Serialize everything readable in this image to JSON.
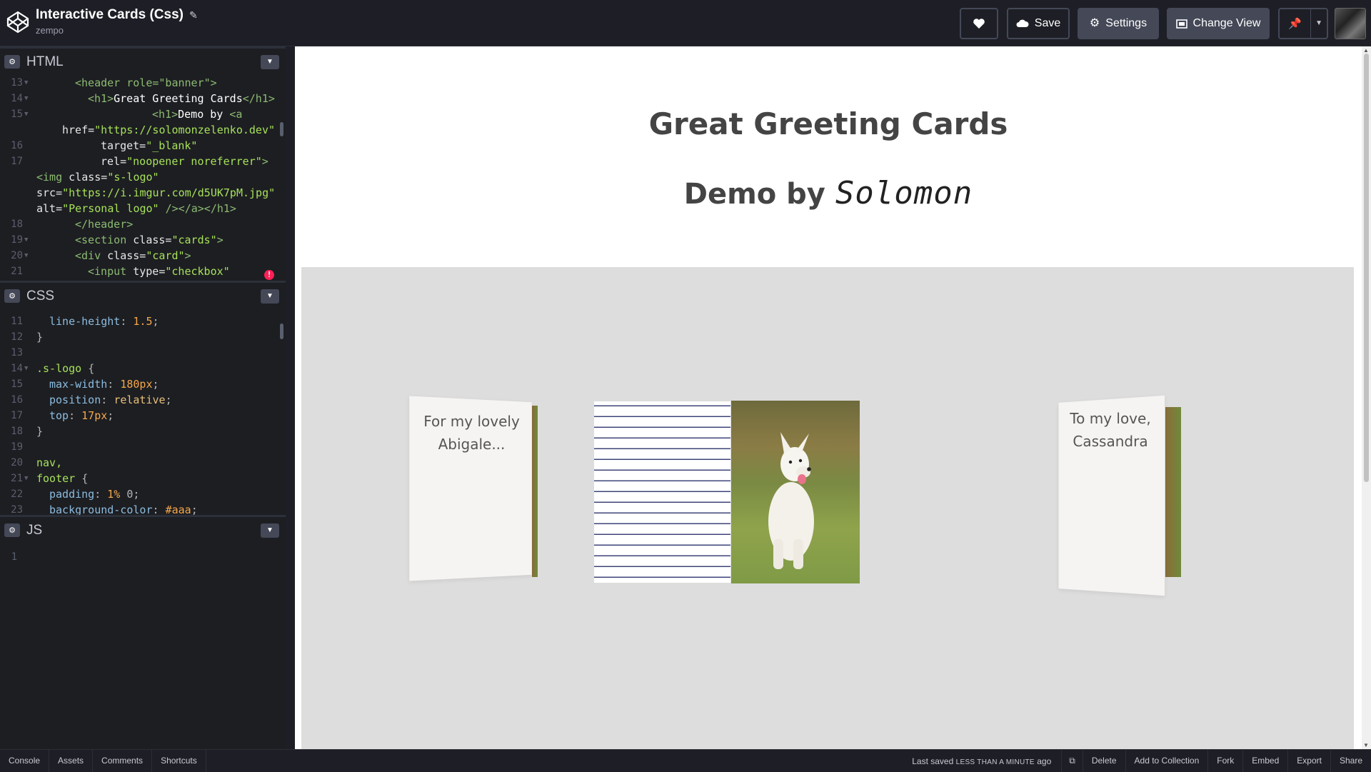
{
  "header": {
    "title": "Interactive Cards (Css)",
    "author": "zempo",
    "buttons": {
      "like_label": "",
      "save_label": "Save",
      "settings_label": "Settings",
      "change_view_label": "Change View"
    }
  },
  "editors": {
    "html": {
      "name": "HTML",
      "lines": [
        {
          "n": "13",
          "fold": true
        },
        {
          "n": "14",
          "fold": true
        },
        {
          "n": "15",
          "fold": true
        },
        {
          "n": "",
          "fold": false
        },
        {
          "n": "16",
          "fold": false
        },
        {
          "n": "17",
          "fold": false
        },
        {
          "n": "",
          "fold": false
        },
        {
          "n": "",
          "fold": false
        },
        {
          "n": "",
          "fold": false
        },
        {
          "n": "18",
          "fold": false
        },
        {
          "n": "19",
          "fold": true
        },
        {
          "n": "20",
          "fold": true
        },
        {
          "n": "21",
          "fold": false
        }
      ],
      "code": {
        "l1": "<header role=\"banner\">",
        "l2a": "<h1>",
        "l2b": "Great Greeting Cards",
        "l2c": "</h1>",
        "l3a": "<h1>",
        "l3b": "Demo by ",
        "l3c": "<a",
        "l4a": "href=",
        "l4b": "\"https://solomonzelenko.dev\"",
        "l5a": "target=",
        "l5b": "\"_blank\"",
        "l6a": "rel=",
        "l6b": "\"noopener noreferrer\"",
        "l6c": ">",
        "l7a": "<img ",
        "l7b": "class=",
        "l7c": "\"s-logo\"",
        "l8a": "src=",
        "l8b": "\"https://i.imgur.com/d5UK7pM.jpg\"",
        "l9a": "alt=",
        "l9b": "\"Personal logo\"",
        "l9c": " /></a></h1>",
        "l10": "</header>",
        "l11a": "<section ",
        "l11b": "class=",
        "l11c": "\"cards\"",
        "l11d": ">",
        "l12a": "<div ",
        "l12b": "class=",
        "l12c": "\"card\"",
        "l12d": ">",
        "l13a": "<input ",
        "l13b": "type=",
        "l13c": "\"checkbox\""
      },
      "error_marker": "!"
    },
    "css": {
      "name": "CSS",
      "lines": [
        "11",
        "12",
        "13",
        "14",
        "15",
        "16",
        "17",
        "18",
        "19",
        "20",
        "21",
        "22",
        "23"
      ],
      "code": {
        "l1a": "line-height",
        "l1b": ": ",
        "l1c": "1.5",
        "l1d": ";",
        "l2": "}",
        "l3": "",
        "l4a": ".s-logo",
        "l4b": " {",
        "l5a": "max-width",
        "l5b": ": ",
        "l5c": "180px",
        "l5d": ";",
        "l6a": "position",
        "l6b": ": ",
        "l6c": "relative",
        "l6d": ";",
        "l7a": "top",
        "l7b": ": ",
        "l7c": "17px",
        "l7d": ";",
        "l8": "}",
        "l9": "",
        "l10": "nav,",
        "l11a": "footer",
        "l11b": " {",
        "l12a": "padding",
        "l12b": ": ",
        "l12c": "1%",
        "l12d": " 0;",
        "l13a": "background-color",
        "l13b": ": ",
        "l13c": "#aaa",
        "l13d": ";"
      }
    },
    "js": {
      "name": "JS",
      "lines": [
        "1"
      ]
    }
  },
  "preview": {
    "site_title": "Great Greeting Cards",
    "demo_by": "Demo by",
    "signature": "Solomon",
    "cards": [
      {
        "text_line1": "For my lovely",
        "text_line2": "Abigale..."
      },
      {
        "text_line1": "",
        "text_line2": ""
      },
      {
        "text_line1": "To my love,",
        "text_line2": "Cassandra"
      }
    ]
  },
  "bottombar": {
    "left": [
      "Console",
      "Assets",
      "Comments",
      "Shortcuts"
    ],
    "saved_prefix": "Last saved",
    "saved_time": "LESS THAN A MINUTE",
    "saved_suffix": "ago",
    "right": [
      "Delete",
      "Add to Collection",
      "Fork",
      "Embed",
      "Export",
      "Share"
    ]
  },
  "colors": {
    "bg_dark": "#1e1f26",
    "button_grey": "#444857",
    "preview_area": "#dddddd",
    "error": "#ff2056"
  },
  "icons": {
    "logo": "codepen-logo-icon",
    "edit": "pencil-icon",
    "like": "heart-icon",
    "save": "cloud-icon",
    "settings": "gear-icon",
    "change_view": "layout-icon",
    "pin": "pin-icon",
    "dropdown": "chevron-down-icon",
    "external": "external-link-icon"
  }
}
